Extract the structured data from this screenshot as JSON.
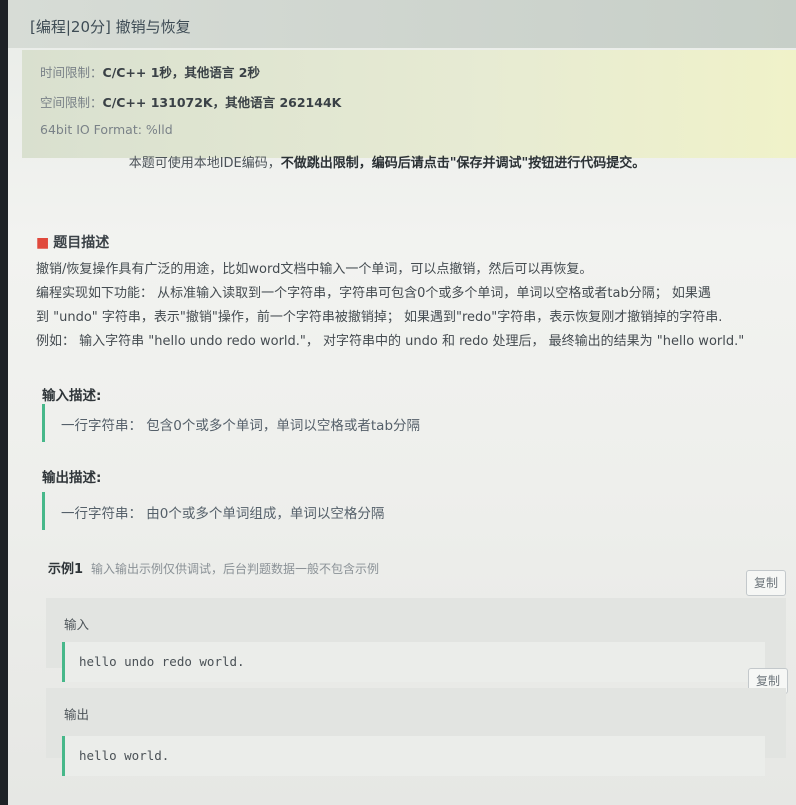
{
  "title": "[编程|20分] 撤销与恢复",
  "limits": {
    "time_label": "时间限制：",
    "time_value": "C/C++ 1秒，其他语言 2秒",
    "space_label": "空间限制：",
    "space_value": "C/C++ 131072K，其他语言 262144K",
    "io_format": "64bit IO Format: %lld"
  },
  "notice": {
    "prefix": "本题可使用本地IDE编码，",
    "emphasis": "不做跳出限制，",
    "suffix": "编码后请点击\"保存并调试\"按钮进行代码提交。"
  },
  "problem": {
    "heading": "题目描述",
    "lines": [
      "撤销/恢复操作具有广泛的用途，比如word文档中输入一个单词，可以点撤销，然后可以再恢复。",
      "编程实现如下功能：  从标准输入读取到一个字符串，字符串可包含0个或多个单词，单词以空格或者tab分隔；  如果遇",
      "到 \"undo\" 字符串，表示\"撤销\"操作，前一个字符串被撤销掉；  如果遇到\"redo\"字符串，表示恢复刚才撤销掉的字符串.",
      "例如：  输入字符串 \"hello undo redo world.\"，  对字符串中的 undo 和 redo 处理后，  最终输出的结果为 \"hello world.\""
    ]
  },
  "input_desc": {
    "label": "输入描述:",
    "text": "一行字符串：  包含0个或多个单词，单词以空格或者tab分隔"
  },
  "output_desc": {
    "label": "输出描述:",
    "text": "一行字符串：  由0个或多个单词组成，单词以空格分隔"
  },
  "example": {
    "title": "示例1",
    "note": "输入输出示例仅供调试，后台判题数据一般不包含示例",
    "copy_label": "复制",
    "input_label": "输入",
    "input_value": "hello undo redo world.",
    "output_label": "输出",
    "output_value": "hello world."
  }
}
